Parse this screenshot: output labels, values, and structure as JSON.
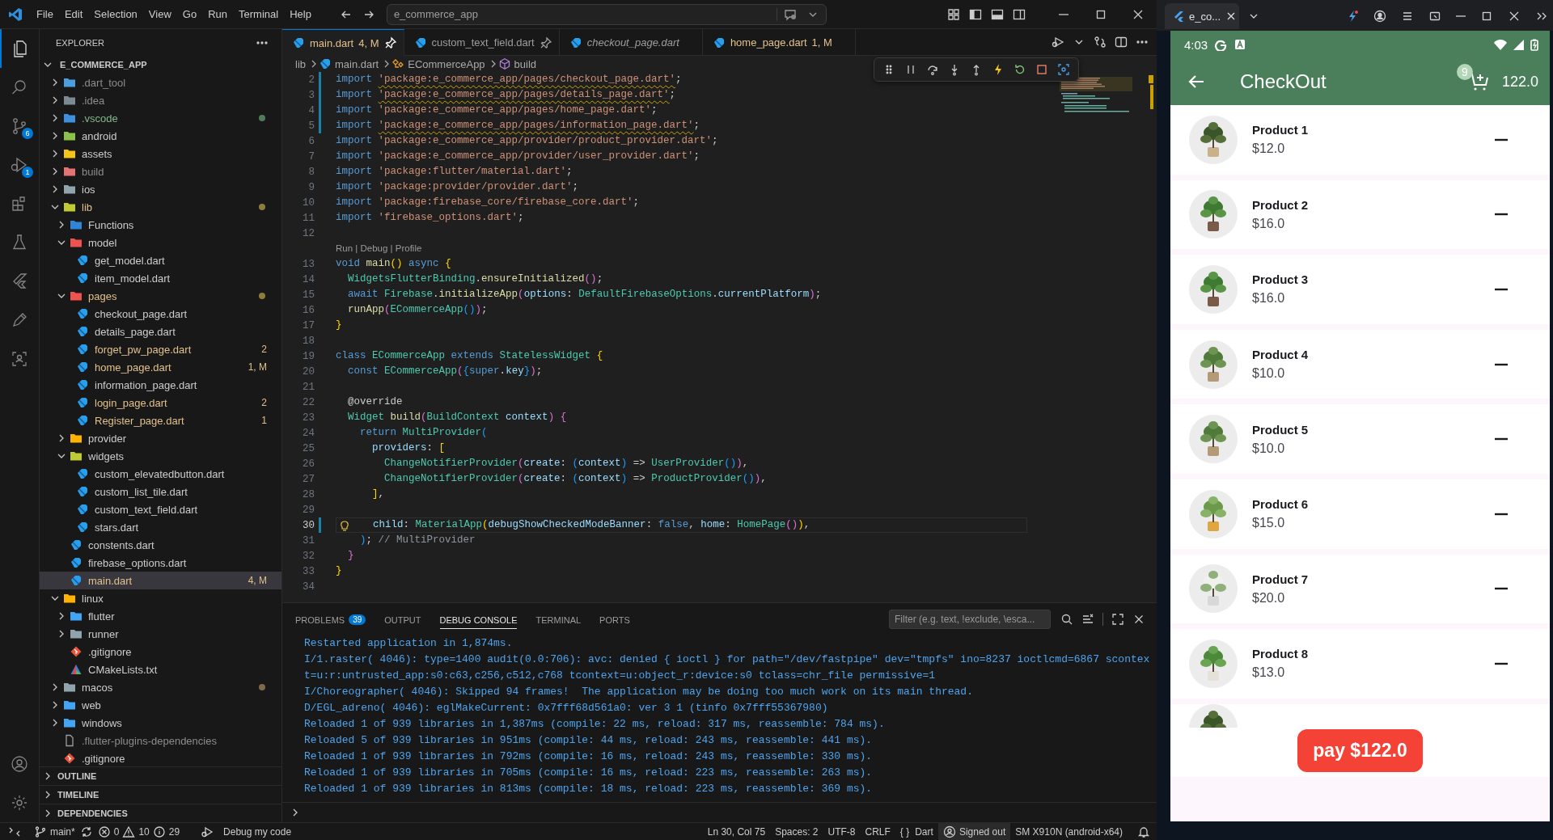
{
  "title_bar": {
    "menus": [
      "File",
      "Edit",
      "Selection",
      "View",
      "Go",
      "Run",
      "Terminal",
      "Help"
    ],
    "search": "e_commerce_app"
  },
  "activity_bar": {
    "items": [
      {
        "kind": "explorer",
        "selected": true
      },
      {
        "kind": "search",
        "selected": false
      },
      {
        "kind": "source-control",
        "selected": false,
        "badge": "6"
      },
      {
        "kind": "run-debug",
        "selected": false,
        "badge": "1"
      },
      {
        "kind": "extensions",
        "selected": false
      },
      {
        "kind": "testing",
        "selected": false
      },
      {
        "kind": "flutter",
        "selected": false
      },
      {
        "kind": "pen",
        "selected": false
      },
      {
        "kind": "scan",
        "selected": false
      }
    ],
    "bottom": [
      {
        "kind": "account"
      },
      {
        "kind": "settings"
      }
    ]
  },
  "explorer": {
    "title": "EXPLORER",
    "root": {
      "label": "E_COMMERCE_APP",
      "expanded": true,
      "children": [
        {
          "label": ".dart_tool",
          "kind": "folder",
          "color": "#4a9fe0",
          "expanded": false,
          "ignored": true,
          "dot": false,
          "selected": false
        },
        {
          "label": ".idea",
          "kind": "folder",
          "color": "#7b8a93",
          "expanded": false,
          "ignored": true,
          "dot": false,
          "selected": false
        },
        {
          "label": ".vscode",
          "kind": "folder",
          "color": "#3f8fe0",
          "expanded": false,
          "untracked": true,
          "dot": true,
          "selected": false
        },
        {
          "label": "android",
          "kind": "folder",
          "color": "#8bc34a",
          "expanded": false,
          "dot": false,
          "selected": false
        },
        {
          "label": "assets",
          "kind": "folder",
          "color": "#f5c518",
          "expanded": false,
          "dot": false,
          "selected": false
        },
        {
          "label": "build",
          "kind": "folder",
          "color": "#e57373",
          "expanded": false,
          "ignored": true,
          "dot": false,
          "selected": false
        },
        {
          "label": "ios",
          "kind": "folder",
          "color": "#90a4ae",
          "expanded": false,
          "dot": false,
          "selected": false
        },
        {
          "label": "lib",
          "kind": "folder",
          "color": "#c0ca33",
          "expanded": true,
          "modified": true,
          "dot": true,
          "selected": false,
          "children": [
            {
              "label": "Functions",
              "kind": "folder",
              "color": "#2f86d6",
              "expanded": false,
              "dot": false,
              "selected": false
            },
            {
              "label": "model",
              "kind": "folder",
              "color": "#ef5350",
              "expanded": true,
              "dot": false,
              "selected": false,
              "children": [
                {
                  "label": "get_model.dart",
                  "kind": "dart",
                  "selected": false
                },
                {
                  "label": "item_model.dart",
                  "kind": "dart",
                  "selected": false
                }
              ]
            },
            {
              "label": "pages",
              "kind": "folder",
              "color": "#ef5350",
              "expanded": true,
              "modified": true,
              "dot": true,
              "selected": false,
              "children": [
                {
                  "label": "checkout_page.dart",
                  "kind": "dart",
                  "selected": false
                },
                {
                  "label": "details_page.dart",
                  "kind": "dart",
                  "selected": false
                },
                {
                  "label": "forget_pw_page.dart",
                  "kind": "dart",
                  "modified": true,
                  "badge": "2",
                  "selected": false
                },
                {
                  "label": "home_page.dart",
                  "kind": "dart",
                  "modified": true,
                  "badge": "1, M",
                  "selected": false
                },
                {
                  "label": "information_page.dart",
                  "kind": "dart",
                  "selected": false
                },
                {
                  "label": "login_page.dart",
                  "kind": "dart",
                  "modified": true,
                  "badge": "2",
                  "selected": false
                },
                {
                  "label": "Register_page.dart",
                  "kind": "dart",
                  "modified": true,
                  "badge": "1",
                  "selected": false
                }
              ]
            },
            {
              "label": "provider",
              "kind": "folder",
              "color": "#ffb300",
              "expanded": false,
              "dot": false,
              "selected": false
            },
            {
              "label": "widgets",
              "kind": "folder",
              "color": "#c0ca33",
              "expanded": true,
              "dot": false,
              "selected": false,
              "children": [
                {
                  "label": "custom_elevatedbutton.dart",
                  "kind": "dart",
                  "selected": false
                },
                {
                  "label": "custom_list_tile.dart",
                  "kind": "dart",
                  "selected": false
                },
                {
                  "label": "custom_text_field.dart",
                  "kind": "dart",
                  "selected": false
                },
                {
                  "label": "stars.dart",
                  "kind": "dart",
                  "selected": false
                }
              ]
            },
            {
              "label": "constents.dart",
              "kind": "dart",
              "selected": false
            },
            {
              "label": "firebase_options.dart",
              "kind": "dart",
              "selected": false
            },
            {
              "label": "main.dart",
              "kind": "dart",
              "modified": true,
              "badge": "4, M",
              "selected": true
            }
          ]
        },
        {
          "label": "linux",
          "kind": "folder",
          "color": "#ffb300",
          "expanded": true,
          "dot": false,
          "selected": false,
          "children": [
            {
              "label": "flutter",
              "kind": "folder",
              "color": "#42a5f5",
              "expanded": false,
              "dot": false,
              "selected": false
            },
            {
              "label": "runner",
              "kind": "folder",
              "color": "#90a4ae",
              "expanded": false,
              "dot": false,
              "selected": false
            },
            {
              "label": ".gitignore",
              "kind": "git",
              "selected": false
            },
            {
              "label": "CMakeLists.txt",
              "kind": "cmake",
              "selected": false
            }
          ]
        },
        {
          "label": "macos",
          "kind": "folder",
          "color": "#90a4ae",
          "expanded": false,
          "dot": true,
          "selected": false
        },
        {
          "label": "web",
          "kind": "folder",
          "color": "#42a5f5",
          "expanded": false,
          "dot": false,
          "selected": false
        },
        {
          "label": "windows",
          "kind": "folder",
          "color": "#42a5f5",
          "expanded": false,
          "dot": false,
          "selected": false
        },
        {
          "label": ".flutter-plugins-dependencies",
          "kind": "text",
          "ignored": true,
          "selected": false
        },
        {
          "label": ".gitignore",
          "kind": "git",
          "selected": false
        }
      ]
    },
    "sections": [
      {
        "label": "OUTLINE",
        "expanded": false
      },
      {
        "label": "TIMELINE",
        "expanded": false
      },
      {
        "label": "DEPENDENCIES",
        "expanded": false
      }
    ]
  },
  "editor": {
    "tabs": [
      {
        "label": "main.dart",
        "badge": "4, M",
        "selected": true,
        "pinned": true,
        "preview": false,
        "modified": true
      },
      {
        "label": "custom_text_field.dart",
        "selected": false,
        "pinned": true,
        "preview": false,
        "modified": false
      },
      {
        "label": "checkout_page.dart",
        "selected": false,
        "pinned": false,
        "preview": true,
        "modified": false
      },
      {
        "label": "home_page.dart",
        "badge": "1, M",
        "selected": false,
        "pinned": false,
        "preview": false,
        "modified": true
      }
    ],
    "breadcrumbs": [
      {
        "label": "lib",
        "kind": "folder"
      },
      {
        "label": "main.dart",
        "kind": "dart"
      },
      {
        "label": "ECommerceApp",
        "kind": "class"
      },
      {
        "label": "build",
        "kind": "method"
      }
    ],
    "lines": [
      {
        "number": "2",
        "modified": true,
        "current": false,
        "warning": true,
        "text": "import 'package:e_commerce_app/pages/checkout_page.dart';"
      },
      {
        "number": "3",
        "modified": true,
        "current": false,
        "warning": true,
        "text": "import 'package:e_commerce_app/pages/details_page.dart';"
      },
      {
        "number": "4",
        "modified": true,
        "current": false,
        "warning": false,
        "text": "import 'package:e_commerce_app/pages/home_page.dart';"
      },
      {
        "number": "5",
        "modified": true,
        "current": false,
        "warning": true,
        "text": "import 'package:e_commerce_app/pages/information_page.dart';"
      },
      {
        "number": "6",
        "modified": false,
        "current": false,
        "warning": false,
        "text": "import 'package:e_commerce_app/provider/product_provider.dart';"
      },
      {
        "number": "7",
        "modified": false,
        "current": false,
        "warning": false,
        "text": "import 'package:e_commerce_app/provider/user_provider.dart';"
      },
      {
        "number": "8",
        "modified": false,
        "current": false,
        "warning": false,
        "text": "import 'package:flutter/material.dart';"
      },
      {
        "number": "9",
        "modified": false,
        "current": false,
        "warning": false,
        "text": "import 'package:provider/provider.dart';"
      },
      {
        "number": "10",
        "modified": false,
        "current": false,
        "warning": false,
        "text": "import 'package:firebase_core/firebase_core.dart';"
      },
      {
        "number": "11",
        "modified": false,
        "current": false,
        "warning": false,
        "text": "import 'firebase_options.dart';"
      },
      {
        "number": "12",
        "modified": false,
        "current": false
      },
      {
        "number": "13",
        "modified": false,
        "current": false,
        "codelens": "Run | Debug | Profile",
        "text": "void main() async {"
      },
      {
        "number": "14",
        "modified": false,
        "current": false,
        "text": "  WidgetsFlutterBinding.ensureInitialized();"
      },
      {
        "number": "15",
        "modified": false,
        "current": false,
        "text": "  await Firebase.initializeApp(options: DefaultFirebaseOptions.currentPlatform);"
      },
      {
        "number": "16",
        "modified": false,
        "current": false,
        "text": "  runApp(ECommerceApp());"
      },
      {
        "number": "17",
        "modified": false,
        "current": false,
        "text": "}"
      },
      {
        "number": "18",
        "modified": false,
        "current": false
      },
      {
        "number": "19",
        "modified": false,
        "current": false,
        "text": "class ECommerceApp extends StatelessWidget {"
      },
      {
        "number": "20",
        "modified": false,
        "current": false,
        "text": "  const ECommerceApp({super.key});"
      },
      {
        "number": "21",
        "modified": false,
        "current": false
      },
      {
        "number": "22",
        "modified": false,
        "current": false,
        "text": "  @override"
      },
      {
        "number": "23",
        "modified": false,
        "current": false,
        "text": "  Widget build(BuildContext context) {"
      },
      {
        "number": "24",
        "modified": false,
        "current": false,
        "text": "    return MultiProvider("
      },
      {
        "number": "25",
        "modified": false,
        "current": false,
        "text": "      providers: ["
      },
      {
        "number": "26",
        "modified": false,
        "current": false,
        "text": "        ChangeNotifierProvider(create: (context) => UserProvider()),"
      },
      {
        "number": "27",
        "modified": false,
        "current": false,
        "text": "        ChangeNotifierProvider(create: (context) => ProductProvider()),"
      },
      {
        "number": "28",
        "modified": false,
        "current": false,
        "text": "      ],"
      },
      {
        "number": "29",
        "modified": false,
        "current": false
      },
      {
        "number": "30",
        "modified": true,
        "current": true,
        "text": "      child: MaterialApp(debugShowCheckedModeBanner: false, home: HomePage()),"
      },
      {
        "number": "31",
        "modified": false,
        "current": false,
        "text": "    ); // MultiProvider"
      },
      {
        "number": "32",
        "modified": false,
        "current": false,
        "text": "  }"
      },
      {
        "number": "33",
        "modified": false,
        "current": false,
        "text": "}"
      },
      {
        "number": "34",
        "modified": false,
        "current": false
      }
    ]
  },
  "panel": {
    "tabs": [
      {
        "label": "PROBLEMS",
        "badge": "39",
        "selected": false
      },
      {
        "label": "OUTPUT",
        "selected": false
      },
      {
        "label": "DEBUG CONSOLE",
        "selected": true
      },
      {
        "label": "TERMINAL",
        "selected": false
      },
      {
        "label": "PORTS",
        "selected": false
      }
    ],
    "filter_placeholder": "Filter (e.g. text, !exclude, \\esca...",
    "console": [
      "Restarted application in 1,874ms.",
      "I/1.raster( 4046): type=1400 audit(0.0:706): avc: denied { ioctl } for path=\"/dev/fastpipe\" dev=\"tmpfs\" ino=8237 ioctlcmd=6867 scontext=u:r:untrusted_app:s0:c63,c256,c512,c768 tcontext=u:object_r:device:s0 tclass=chr_file permissive=1",
      "I/Choreographer( 4046): Skipped 94 frames!  The application may be doing too much work on its main thread.",
      "D/EGL_adreno( 4046): eglMakeCurrent: 0x7fff68d561a0: ver 3 1 (tinfo 0x7fff55367980)",
      "Reloaded 1 of 939 libraries in 1,387ms (compile: 22 ms, reload: 317 ms, reassemble: 784 ms).",
      "Reloaded 5 of 939 libraries in 951ms (compile: 44 ms, reload: 243 ms, reassemble: 441 ms).",
      "Reloaded 1 of 939 libraries in 792ms (compile: 16 ms, reload: 243 ms, reassemble: 330 ms).",
      "Reloaded 1 of 939 libraries in 705ms (compile: 16 ms, reload: 223 ms, reassemble: 263 ms).",
      "Reloaded 1 of 939 libraries in 813ms (compile: 18 ms, reload: 223 ms, reassemble: 369 ms)."
    ]
  },
  "status_bar": {
    "branch": "main*",
    "errors": "0",
    "warnings": "10",
    "infos": "29",
    "debug_label": "Debug my code",
    "right": [
      {
        "kind": "plain",
        "text": "Ln 30, Col 75"
      },
      {
        "kind": "plain",
        "text": "Spaces: 2"
      },
      {
        "kind": "plain",
        "text": "UTF-8"
      },
      {
        "kind": "plain",
        "text": "CRLF"
      },
      {
        "kind": "language",
        "icon": "{ }",
        "text": "Dart"
      },
      {
        "kind": "account",
        "text": "Signed out"
      },
      {
        "kind": "plain",
        "text": "SM X910N (android-x64)"
      }
    ]
  },
  "emulator": {
    "tab": "e_co...",
    "phone": {
      "time": "4:03",
      "title": "CheckOut",
      "cart_count": "9",
      "total": "122.0",
      "items": [
        {
          "kind": "product",
          "name": "Product 1",
          "price": "$12.0"
        },
        {
          "kind": "product",
          "name": "Product 2",
          "price": "$16.0"
        },
        {
          "kind": "product",
          "name": "Product 3",
          "price": "$16.0"
        },
        {
          "kind": "product",
          "name": "Product 4",
          "price": "$10.0"
        },
        {
          "kind": "product",
          "name": "Product 5",
          "price": "$10.0"
        },
        {
          "kind": "product",
          "name": "Product 6",
          "price": "$15.0"
        },
        {
          "kind": "product",
          "name": "Product 7",
          "price": "$20.0"
        },
        {
          "kind": "product",
          "name": "Product 8",
          "price": "$13.0"
        },
        {
          "kind": "picture"
        }
      ],
      "pay_button": "pay $122.0"
    }
  }
}
